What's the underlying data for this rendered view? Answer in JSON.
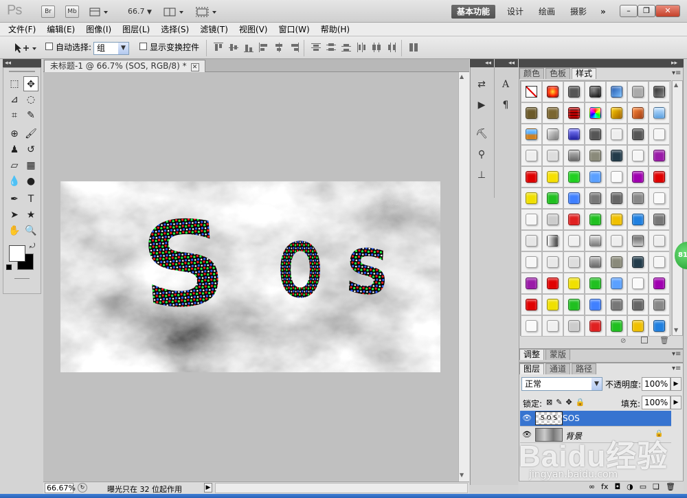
{
  "app": {
    "logo": "Ps",
    "bridge_label": "Br",
    "minibridge_label": "Mb",
    "zoom": "66.7",
    "workspaces": [
      "基本功能",
      "设计",
      "绘画",
      "摄影"
    ],
    "more": "»"
  },
  "menu": [
    "文件(F)",
    "编辑(E)",
    "图像(I)",
    "图层(L)",
    "选择(S)",
    "滤镜(T)",
    "视图(V)",
    "窗口(W)",
    "帮助(H)"
  ],
  "options": {
    "auto_select_label": "自动选择:",
    "auto_select_value": "组",
    "show_transform_label": "显示变换控件"
  },
  "document": {
    "tab_title": "未标题-1 @ 66.7% (SOS, RGB/8) *",
    "image_text": [
      "S",
      "O",
      "S"
    ]
  },
  "status": {
    "zoom": "66.67%",
    "info": "曝光只在 32 位起作用"
  },
  "panels": {
    "color_tabs": [
      "颜色",
      "色板",
      "样式"
    ],
    "adjust_tabs": [
      "调整",
      "蒙版"
    ],
    "layer_tabs": [
      "图层",
      "通道",
      "路径"
    ],
    "blend_mode": "正常",
    "opacity_label": "不透明度:",
    "opacity_value": "100%",
    "lock_label": "锁定:",
    "fill_label": "填充:",
    "fill_value": "100%",
    "layers": [
      {
        "name": "SOS"
      },
      {
        "name": "背景"
      }
    ]
  },
  "badge": "81",
  "watermark": {
    "text": "Baidu经验",
    "url": "jingyan.baidu.com"
  }
}
